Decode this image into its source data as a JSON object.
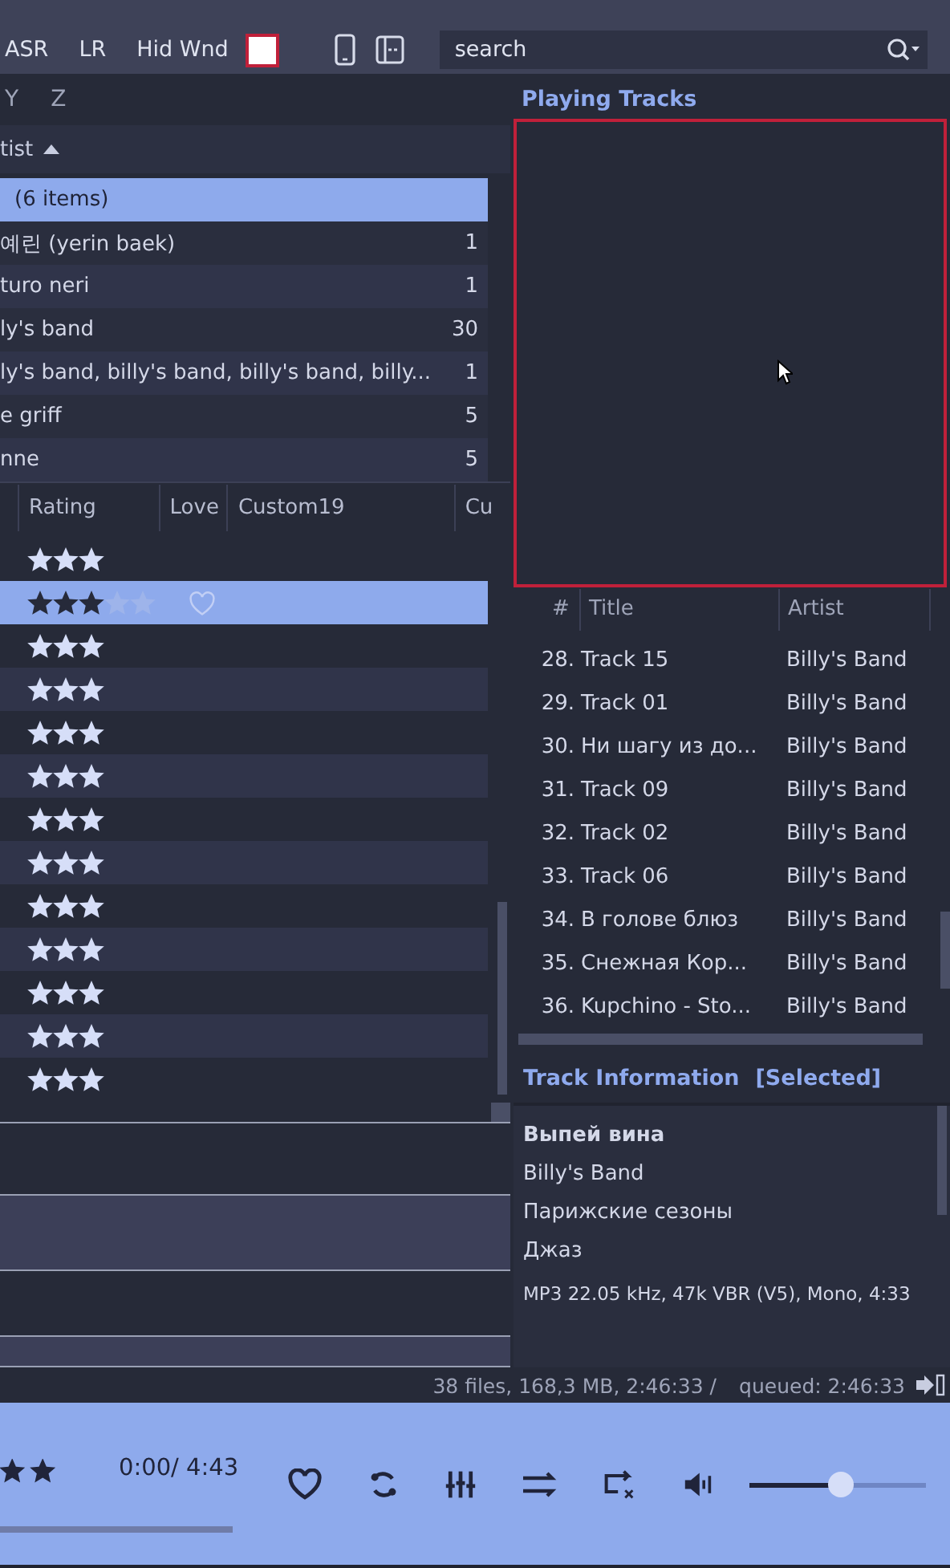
{
  "toolbar": {
    "buttons": [
      "ASR",
      "LR",
      "Hid Wnd"
    ],
    "search": {
      "placeholder": "search"
    }
  },
  "letters": [
    "Y",
    "Z"
  ],
  "artists": {
    "header": "tist",
    "rows": [
      {
        "name": "(6 items)",
        "count": "",
        "selected": true
      },
      {
        "name": "예린 (yerin baek)",
        "count": "1",
        "selected": false
      },
      {
        "name": "turo neri",
        "count": "1",
        "selected": false
      },
      {
        "name": "ly's band",
        "count": "30",
        "selected": false
      },
      {
        "name": "ly's band, billy's band, billy's band, billy...",
        "count": "1",
        "selected": false
      },
      {
        "name": "e griff",
        "count": "5",
        "selected": false
      },
      {
        "name": "nne",
        "count": "5",
        "selected": false
      }
    ]
  },
  "tracks": {
    "columns": [
      "Rating",
      "Love",
      "Custom19",
      "Cu"
    ],
    "rows": [
      {
        "stars": 3,
        "selected": false
      },
      {
        "stars": 3,
        "selected": true
      },
      {
        "stars": 3,
        "selected": false
      },
      {
        "stars": 3,
        "selected": false
      },
      {
        "stars": 3,
        "selected": false
      },
      {
        "stars": 3,
        "selected": false
      },
      {
        "stars": 3,
        "selected": false
      },
      {
        "stars": 3,
        "selected": false
      },
      {
        "stars": 3,
        "selected": false
      },
      {
        "stars": 3,
        "selected": false
      },
      {
        "stars": 3,
        "selected": false
      },
      {
        "stars": 3,
        "selected": false
      },
      {
        "stars": 3,
        "selected": false
      }
    ]
  },
  "playing": {
    "title": "Playing Tracks",
    "columns": [
      "#",
      "Title",
      "Artist"
    ],
    "rows": [
      {
        "number": "28.",
        "title": "Track 15",
        "artist": "Billy's Band"
      },
      {
        "number": "29.",
        "title": "Track 01",
        "artist": "Billy's Band"
      },
      {
        "number": "30.",
        "title": "Ни шагу из до...",
        "artist": "Billy's Band"
      },
      {
        "number": "31.",
        "title": "Track 09",
        "artist": "Billy's Band"
      },
      {
        "number": "32.",
        "title": "Track 02",
        "artist": "Billy's Band"
      },
      {
        "number": "33.",
        "title": "Track 06",
        "artist": "Billy's Band"
      },
      {
        "number": "34.",
        "title": "В голове блюз",
        "artist": "Billy's Band"
      },
      {
        "number": "35.",
        "title": "Снежная Кор...",
        "artist": "Billy's Band"
      },
      {
        "number": "36.",
        "title": "Kupchino - Sto...",
        "artist": "Billy's Band"
      }
    ]
  },
  "info": {
    "title": "Track Information",
    "tag": "[Selected]",
    "track": "Выпей вина",
    "artist": "Billy's Band",
    "album": "Парижские сезоны",
    "genre": "Джаз",
    "format": "MP3 22.05 kHz, 47k VBR (V5), Mono, 4:33"
  },
  "status": {
    "summary": "38 files, 168,3 MB, 2:46:33 /",
    "queued": "queued: 2:46:33"
  },
  "player": {
    "time": "0:00/ 4:43",
    "progress": {
      "level": 0
    },
    "volume": {
      "level": 0.52
    }
  }
}
